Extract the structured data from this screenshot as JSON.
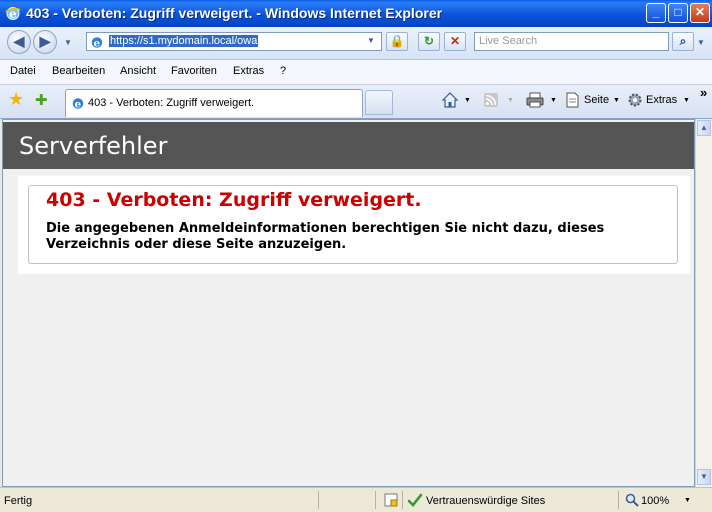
{
  "window": {
    "title": "403 - Verboten: Zugriff verweigert. - Windows Internet Explorer",
    "minimize": "_",
    "maximize": "□",
    "close": "✕"
  },
  "nav": {
    "back": "◀",
    "forward": "▶",
    "dropdown": "▼",
    "address_url": "https://s1.mydomain.local/owa",
    "lock": "🔒",
    "refresh": "↻",
    "stop": "✕",
    "search_placeholder": "Live Search",
    "search_go": "⌕"
  },
  "menu": {
    "items": [
      "Datei",
      "Bearbeiten",
      "Ansicht",
      "Favoriten",
      "Extras",
      "?"
    ]
  },
  "tabs": {
    "favorites_star": "★",
    "add_favorite": "✚",
    "active_tab_label": "403 - Verboten: Zugriff verweigert.",
    "toolbar_page": "Seite",
    "toolbar_tools": "Extras",
    "more": "»"
  },
  "page": {
    "header_title": "Serverfehler",
    "error_title": "403 - Verboten: Zugriff verweigert.",
    "error_message": "Die angegebenen Anmeldeinformationen berechtigen Sie nicht dazu, dieses Verzeichnis oder diese Seite anzuzeigen."
  },
  "status": {
    "text": "Fertig",
    "zone": "Vertrauenswürdige Sites",
    "zoom": "100%"
  },
  "colors": {
    "header_bg": "#555555",
    "error_red": "#cc0000",
    "titlebar_blue": "#0a54dc"
  }
}
